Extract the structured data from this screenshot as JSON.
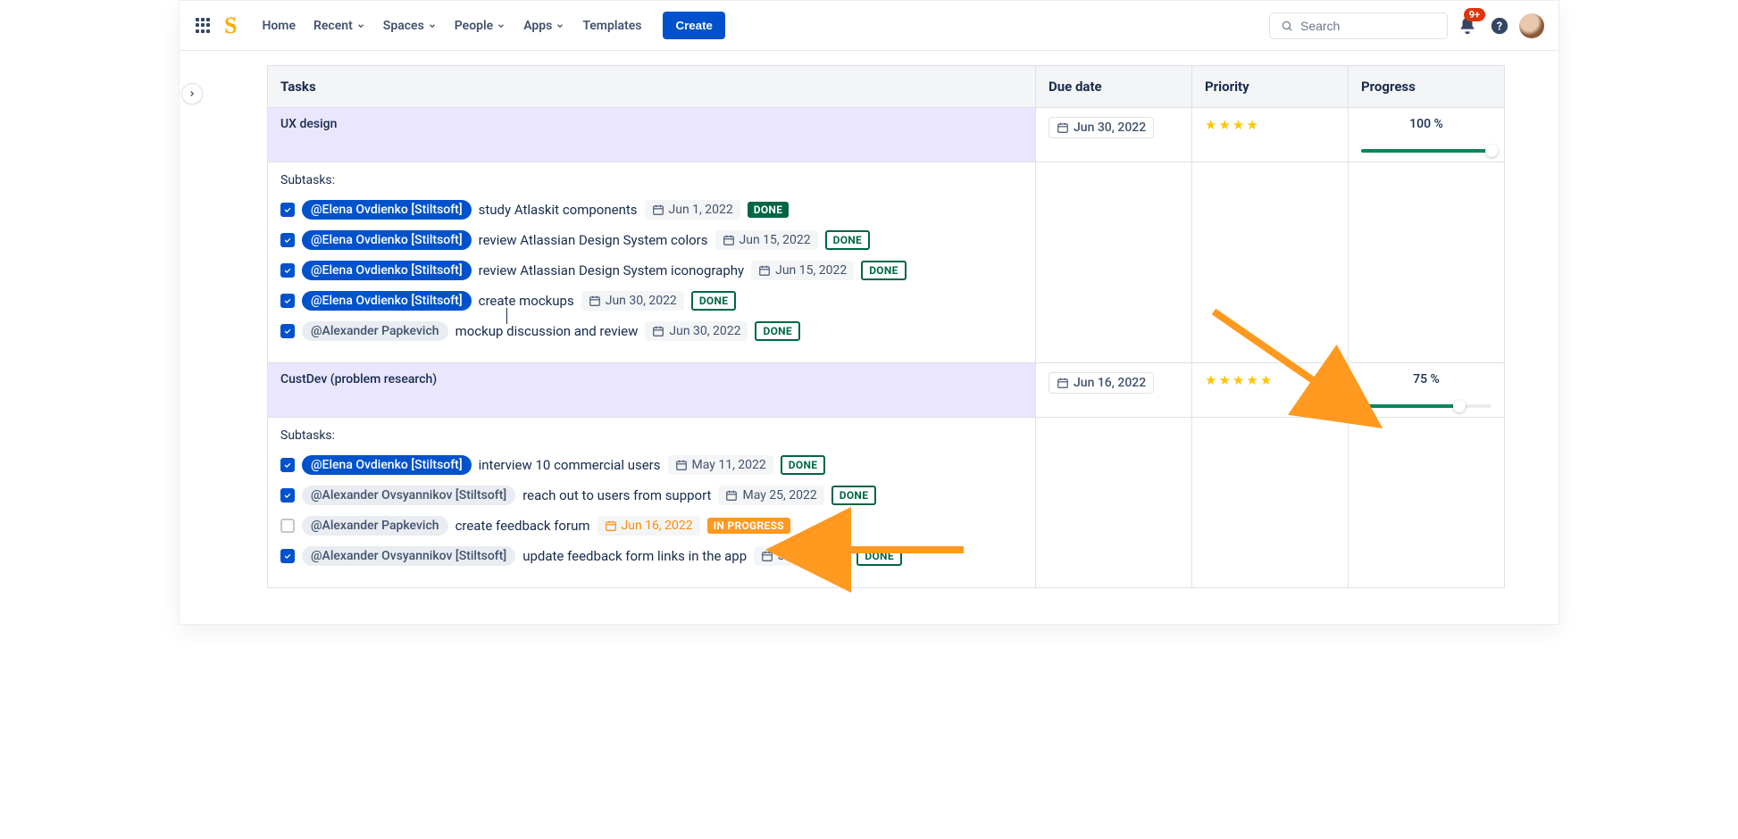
{
  "topnav": {
    "items": [
      "Home",
      "Recent",
      "Spaces",
      "People",
      "Apps",
      "Templates"
    ],
    "dropdown_flags": [
      false,
      true,
      true,
      true,
      true,
      false
    ],
    "create_label": "Create",
    "search_placeholder": "Search",
    "notif_badge": "9+"
  },
  "table": {
    "headers": {
      "tasks": "Tasks",
      "due": "Due date",
      "priority": "Priority",
      "progress": "Progress"
    },
    "groups": [
      {
        "name": "UX design",
        "due": "Jun 30, 2022",
        "priority_stars": 4,
        "progress": 100,
        "subtasks_label": "Subtasks:",
        "subtasks": [
          {
            "checked": true,
            "mention": "@Elena Ovdienko [Stiltsoft]",
            "mention_style": "blue",
            "text": "study Atlaskit components",
            "date": "Jun 1, 2022",
            "status": "DONE",
            "status_style": "done"
          },
          {
            "checked": true,
            "mention": "@Elena Ovdienko [Stiltsoft]",
            "mention_style": "blue",
            "text": "review Atlassian Design System colors",
            "date": "Jun 15, 2022",
            "status": "DONE",
            "status_style": "done-outline"
          },
          {
            "checked": true,
            "mention": "@Elena Ovdienko [Stiltsoft]",
            "mention_style": "blue",
            "text": "review Atlassian Design System iconography",
            "date": "Jun 15, 2022",
            "status": "DONE",
            "status_style": "done-outline"
          },
          {
            "checked": true,
            "mention": "@Elena Ovdienko [Stiltsoft]",
            "mention_style": "blue",
            "text": "create mockups",
            "date": "Jun 30, 2022",
            "status": "DONE",
            "status_style": "done-outline"
          },
          {
            "checked": true,
            "mention": "@Alexander Papkevich",
            "mention_style": "grey",
            "text": "mockup discussion and review",
            "date": "Jun 30, 2022",
            "status": "DONE",
            "status_style": "done-outline"
          }
        ]
      },
      {
        "name": "CustDev (problem research)",
        "due": "Jun 16, 2022",
        "priority_stars": 5,
        "progress": 75,
        "subtasks_label": "Subtasks:",
        "subtasks": [
          {
            "checked": true,
            "mention": "@Elena Ovdienko [Stiltsoft]",
            "mention_style": "blue",
            "text": "interview 10 commercial users",
            "date": "May 11, 2022",
            "status": "DONE",
            "status_style": "done-outline"
          },
          {
            "checked": true,
            "mention": "@Alexander Ovsyannikov [Stiltsoft]",
            "mention_style": "grey",
            "text": "reach out to users from support",
            "date": "May 25, 2022",
            "status": "DONE",
            "status_style": "done-outline"
          },
          {
            "checked": false,
            "mention": "@Alexander Papkevich",
            "mention_style": "grey",
            "text": "create feedback forum",
            "date": "Jun 16, 2022",
            "date_style": "orange",
            "status": "IN PROGRESS",
            "status_style": "inprog"
          },
          {
            "checked": true,
            "mention": "@Alexander Ovsyannikov [Stiltsoft]",
            "mention_style": "grey",
            "text": "update feedback form links in the app",
            "date": "Jun 1, 2022",
            "status": "DONE",
            "status_style": "done-outline"
          }
        ]
      }
    ]
  }
}
